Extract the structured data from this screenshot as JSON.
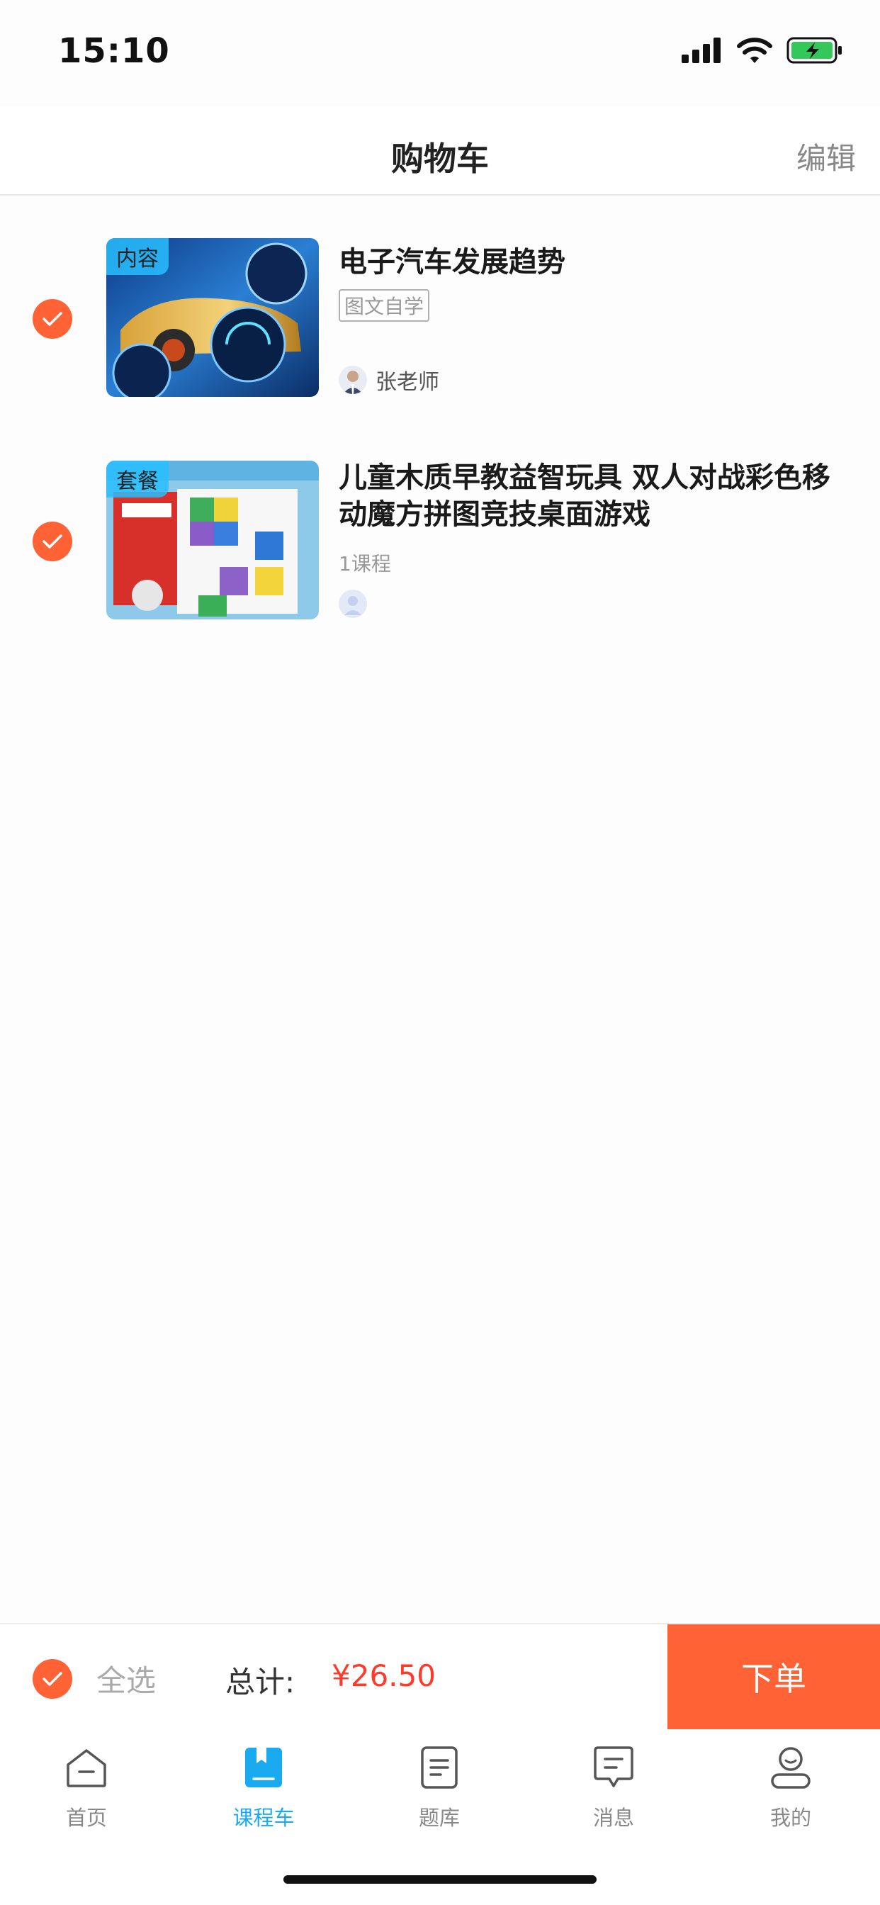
{
  "status_bar": {
    "time": "15:10"
  },
  "nav": {
    "title": "购物车",
    "edit_label": "编辑"
  },
  "cart": {
    "items": [
      {
        "tag": "内容",
        "title": "电子汽车发展趋势",
        "badge": "图文自学",
        "teacher": "张老师",
        "checked": true
      },
      {
        "tag": "套餐",
        "title": "儿童木质早教益智玩具 双人对战彩色移动魔方拼图竞技桌面游戏",
        "meta": "1课程",
        "checked": true
      }
    ]
  },
  "bottom_bar": {
    "select_all_label": "全选",
    "total_label": "总计:",
    "total_price": "¥26.50",
    "order_label": "下单"
  },
  "tabs": [
    {
      "label": "首页",
      "icon": "home-icon"
    },
    {
      "label": "课程车",
      "icon": "bookmark-icon",
      "active": true
    },
    {
      "label": "题库",
      "icon": "document-icon"
    },
    {
      "label": "消息",
      "icon": "message-icon"
    },
    {
      "label": "我的",
      "icon": "profile-icon"
    }
  ],
  "colors": {
    "accent": "#ff6235",
    "active_tab": "#1aaaf0",
    "price": "#ff3a2a"
  }
}
